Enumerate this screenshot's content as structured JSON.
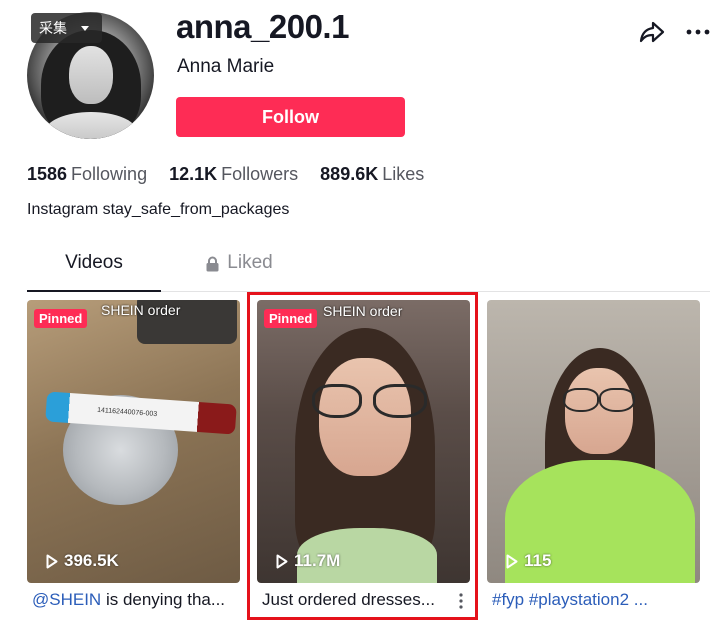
{
  "collect_badge": {
    "label": "采集"
  },
  "profile": {
    "username": "anna_200.1",
    "display_name": "Anna Marie",
    "follow_label": "Follow",
    "bio": "Instagram stay_safe_from_packages",
    "stats": [
      {
        "value": "1586",
        "label": "Following"
      },
      {
        "value": "12.1K",
        "label": "Followers"
      },
      {
        "value": "889.6K",
        "label": "Likes"
      }
    ]
  },
  "tabs": [
    {
      "label": "Videos",
      "active": true
    },
    {
      "label": "Liked",
      "active": false,
      "icon": "lock-icon"
    }
  ],
  "videos": [
    {
      "pinned": "Pinned",
      "overlay": "SHEIN order",
      "views": "396.5K",
      "mention": "@SHEIN",
      "desc": " is denying tha..."
    },
    {
      "pinned": "Pinned",
      "overlay": "SHEIN order",
      "views": "11.7M",
      "desc": "Just ordered dresses..."
    },
    {
      "views": "115",
      "desc": "#fyp #playstation2 ..."
    }
  ],
  "tube_label": "141162440076-003",
  "colors": {
    "accent": "#fe2c55",
    "link": "#2b5db9",
    "highlight": "#e5121b"
  }
}
